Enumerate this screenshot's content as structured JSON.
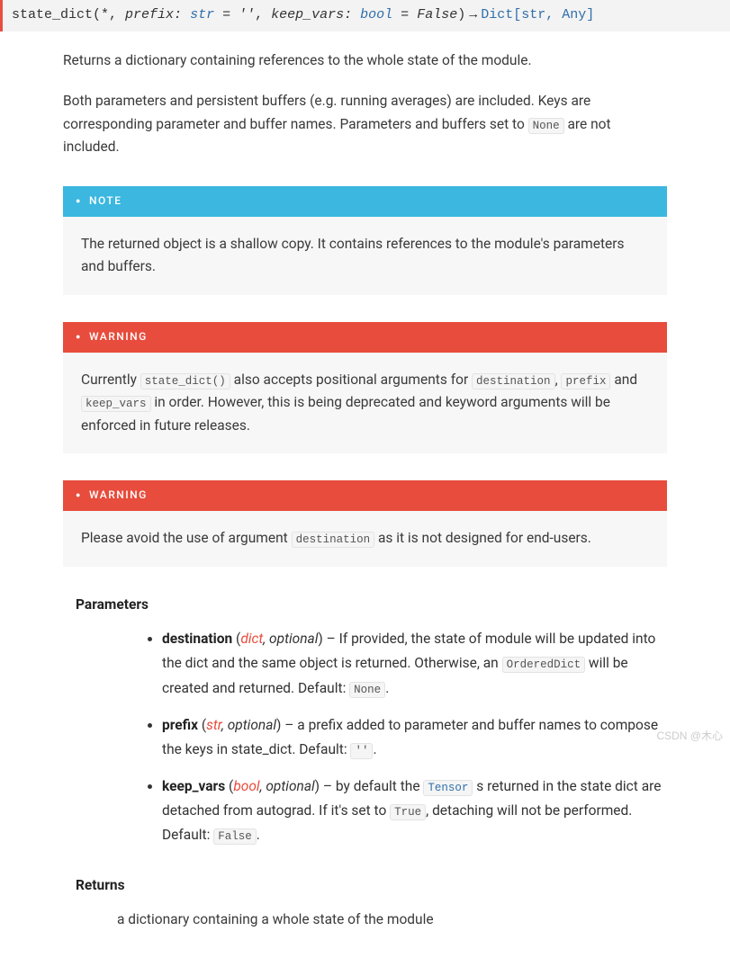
{
  "signature": {
    "name": "state_dict",
    "open": "(*, ",
    "p1_name": "prefix",
    "p1_type": "str",
    "p1_eq": " = ",
    "p1_default": "''",
    "sep1": ", ",
    "p2_name": "keep_vars",
    "p2_type": "bool",
    "p2_eq": " = ",
    "p2_default": "False",
    "close": ")",
    "arrow": "→",
    "return_type": "Dict[str, Any]"
  },
  "desc": {
    "p1": "Returns a dictionary containing references to the whole state of the module.",
    "p2_a": "Both parameters and persistent buffers (e.g. running averages) are included. Keys are corresponding parameter and buffer names. Parameters and buffers set to ",
    "p2_code": "None",
    "p2_b": " are not included."
  },
  "note": {
    "title": "NOTE",
    "body": "The returned object is a shallow copy. It contains references to the module's parameters and buffers."
  },
  "warn1": {
    "title": "WARNING",
    "a": "Currently ",
    "c1": "state_dict()",
    "b": " also accepts positional arguments for ",
    "c2": "destination",
    "c": ", ",
    "c3": "prefix",
    "d": " and ",
    "c4": "keep_vars",
    "e": " in order. However, this is being deprecated and keyword arguments will be enforced in future releases."
  },
  "warn2": {
    "title": "WARNING",
    "a": "Please avoid the use of argument ",
    "c1": "destination",
    "b": " as it is not designed for end-users."
  },
  "params": {
    "heading": "Parameters",
    "p1": {
      "name": "destination",
      "type_link": "dict",
      "optional": ", optional",
      "a": ") – If provided, the state of module will be updated into the dict and the same object is returned. Otherwise, an ",
      "code1": "OrderedDict",
      "b": " will be created and returned. Default: ",
      "code2": "None",
      "c": "."
    },
    "p2": {
      "name": "prefix",
      "type_link": "str",
      "optional": ", optional",
      "a": ") – a prefix added to parameter and buffer names to compose the keys in state_dict. Default: ",
      "code1": "''",
      "b": "."
    },
    "p3": {
      "name": "keep_vars",
      "type_link": "bool",
      "optional": ", optional",
      "a": ") – by default the ",
      "code1": "Tensor",
      "b": " s returned in the state dict are detached from autograd. If it's set to ",
      "code2": "True",
      "c": ", detaching will not be performed. Default: ",
      "code3": "False",
      "d": "."
    }
  },
  "returns": {
    "heading": "Returns",
    "body": "a dictionary containing a whole state of the module"
  },
  "watermark": "CSDN @木心"
}
